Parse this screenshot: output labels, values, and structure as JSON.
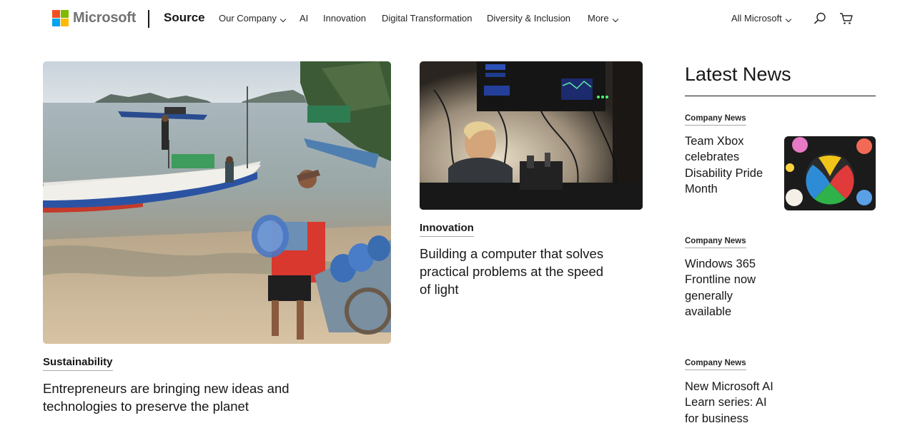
{
  "header": {
    "logo_text": "Microsoft",
    "logo_colors": [
      "#f25022",
      "#7fba00",
      "#00a4ef",
      "#ffb900"
    ],
    "site_name": "Source",
    "nav": [
      {
        "label": "Our Company",
        "has_dropdown": true
      },
      {
        "label": "AI",
        "has_dropdown": false
      },
      {
        "label": "Innovation",
        "has_dropdown": false
      },
      {
        "label": "Digital Transformation",
        "has_dropdown": false
      },
      {
        "label": "Diversity & Inclusion",
        "has_dropdown": false
      },
      {
        "label": "More",
        "has_dropdown": true
      }
    ],
    "all_microsoft": "All Microsoft",
    "icons": [
      "search-icon",
      "cart-icon"
    ]
  },
  "features": [
    {
      "category": "Sustainability",
      "headline": "Entrepreneurs are bringing new ideas and technologies to preserve the planet",
      "image": "people-carrying-water-jugs-from-boats-on-beach"
    },
    {
      "category": "Innovation",
      "headline": "Building a computer that solves practical problems at the speed of light",
      "image": "researcher-with-optical-computer-lab-equipment"
    }
  ],
  "latest_news": {
    "title": "Latest News",
    "items": [
      {
        "category": "Company News",
        "title": "Team Xbox celebrates Disability Pride Month",
        "thumbnail": "xbox-logo-with-stickers"
      },
      {
        "category": "Company News",
        "title": "Windows 365 Frontline now generally available"
      },
      {
        "category": "Company News",
        "title": "New Microsoft AI Learn series: AI for business"
      }
    ]
  }
}
